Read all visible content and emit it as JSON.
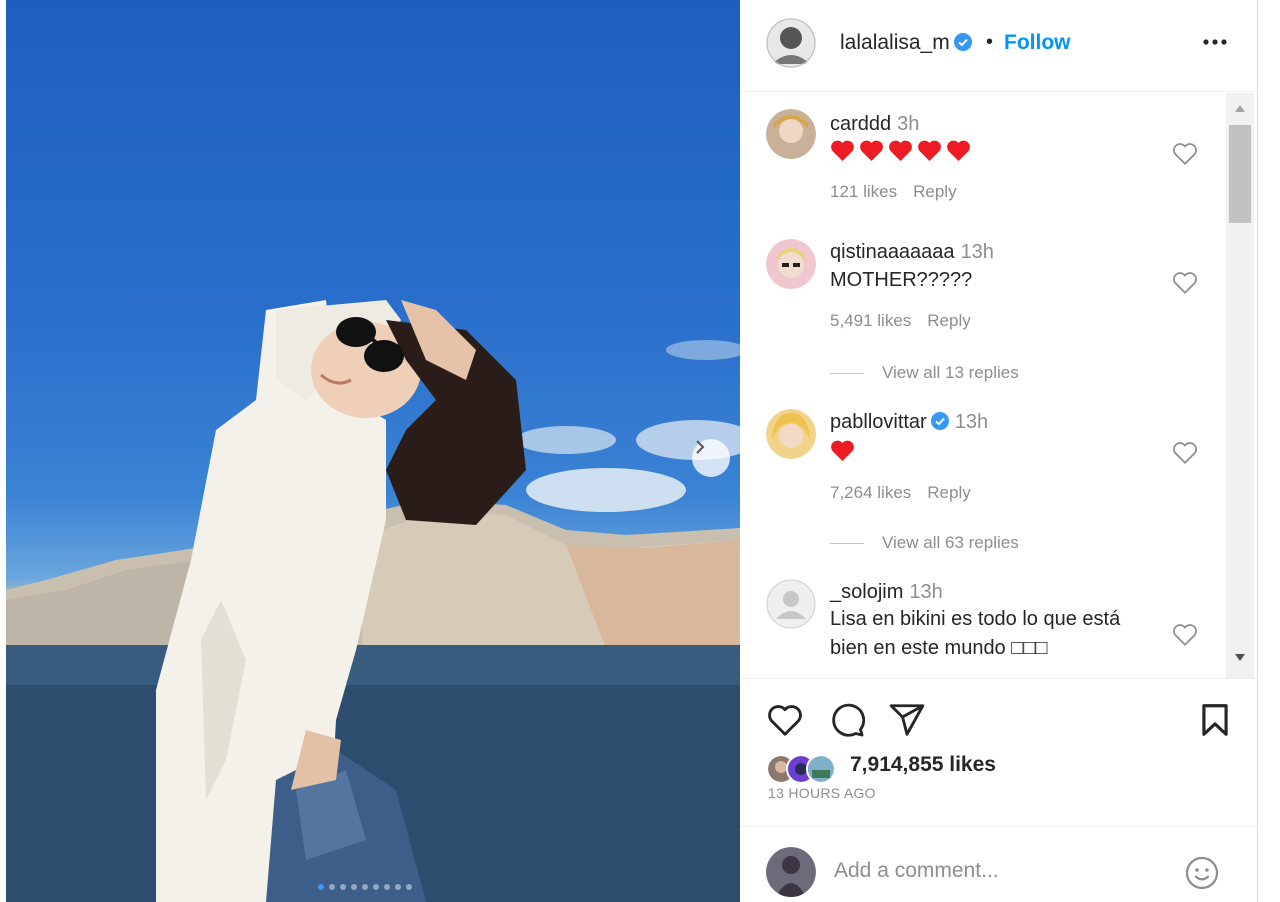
{
  "post": {
    "author": {
      "username": "lalalalisa_m",
      "verified": true,
      "follow_label": "Follow",
      "separator": "•"
    },
    "carousel": {
      "slides": 9,
      "active_index": 0
    }
  },
  "comments": [
    {
      "username": "carddd",
      "time": "3h",
      "text": "",
      "hearts": 5,
      "likes": "121 likes",
      "reply": "Reply",
      "verified": false
    },
    {
      "username": "qistinaaaaaaa",
      "time": "13h",
      "text": "MOTHER?????",
      "hearts": 0,
      "likes": "5,491 likes",
      "reply": "Reply",
      "verified": false,
      "view_replies": "View all 13 replies"
    },
    {
      "username": "pabllovittar",
      "time": "13h",
      "text": "",
      "hearts": 1,
      "likes": "7,264 likes",
      "reply": "Reply",
      "verified": true,
      "view_replies": "View all 63 replies"
    },
    {
      "username": "_solojim",
      "time": "13h",
      "text": "Lisa en bikini es todo lo que está bien en este mundo □□□",
      "verified": false
    }
  ],
  "actions": {
    "likes_total": "7,914,855 likes",
    "posted_ago": "13 HOURS AGO"
  },
  "composer": {
    "placeholder": "Add a comment..."
  },
  "icons": [
    "heart-icon",
    "comment-icon",
    "share-icon",
    "bookmark-icon",
    "emoji-icon",
    "more-icon",
    "chevron-right-icon",
    "verified-icon"
  ],
  "colors": {
    "link": "#0095f6",
    "heart_red": "#ed1c24",
    "verified": "#3897f0",
    "muted": "#8e8e8e"
  }
}
